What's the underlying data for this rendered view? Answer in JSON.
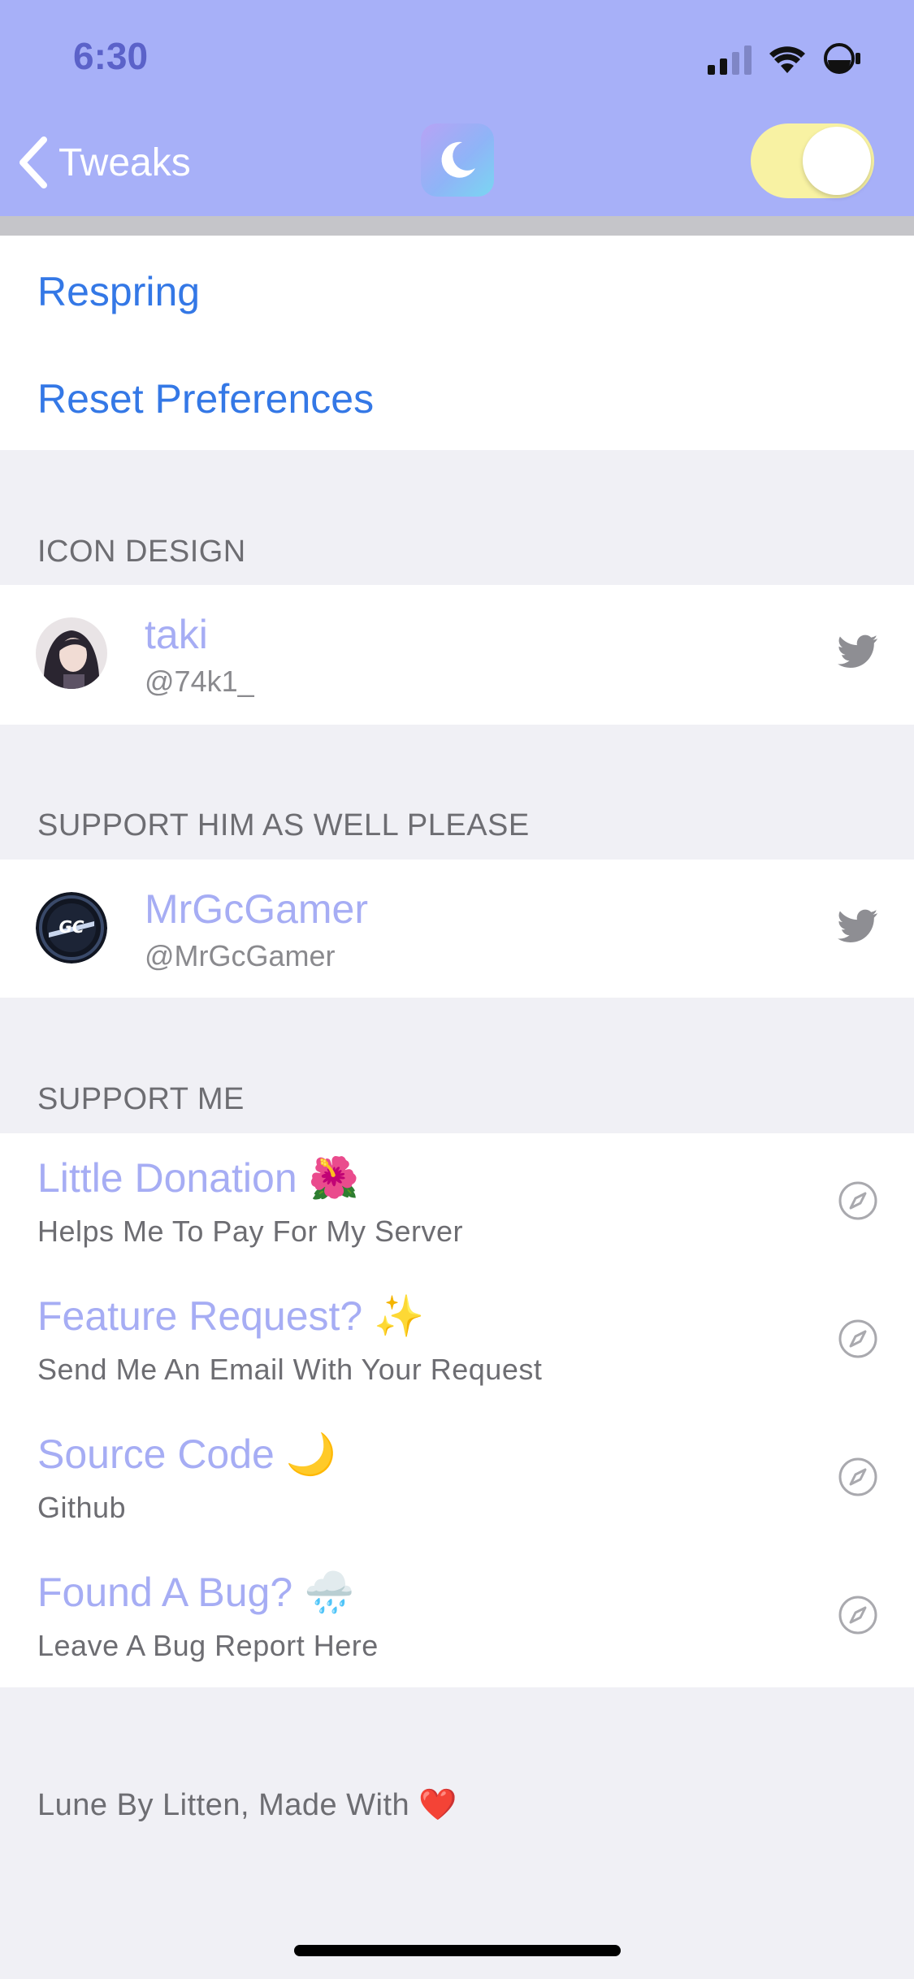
{
  "status_bar": {
    "time": "6:30"
  },
  "nav": {
    "back_label": "Tweaks",
    "toggle_on": true,
    "colors": {
      "header": "#a7b0f8",
      "toggle_track": "#f8f2a3"
    }
  },
  "actions": [
    {
      "label": "Respring"
    },
    {
      "label": "Reset Preferences"
    }
  ],
  "sections": {
    "icon_design": {
      "header": "ICON DESIGN",
      "person": {
        "name": "taki",
        "handle": "@74k1_",
        "icon": "twitter-icon"
      }
    },
    "support_him": {
      "header": "SUPPORT HIM AS WELL PLEASE",
      "person": {
        "name": "MrGcGamer",
        "handle": "@MrGcGamer",
        "icon": "twitter-icon"
      }
    },
    "support_me": {
      "header": "SUPPORT ME",
      "links": [
        {
          "title": "Little Donation 🌺",
          "subtitle": "Helps Me To Pay For My Server",
          "icon": "compass-icon"
        },
        {
          "title": "Feature Request? ✨",
          "subtitle": "Send Me An Email With Your Request",
          "icon": "compass-icon"
        },
        {
          "title": "Source Code 🌙",
          "subtitle": "Github",
          "icon": "compass-icon"
        },
        {
          "title": "Found A Bug? 🌧️",
          "subtitle": "Leave A Bug Report Here",
          "icon": "compass-icon"
        }
      ]
    }
  },
  "footer": {
    "text": "Lune By Litten, Made With ❤️"
  },
  "colors": {
    "link_blue": "#3478e6",
    "accent_lavender": "#a6adf4",
    "background": "#f0f0f5"
  }
}
